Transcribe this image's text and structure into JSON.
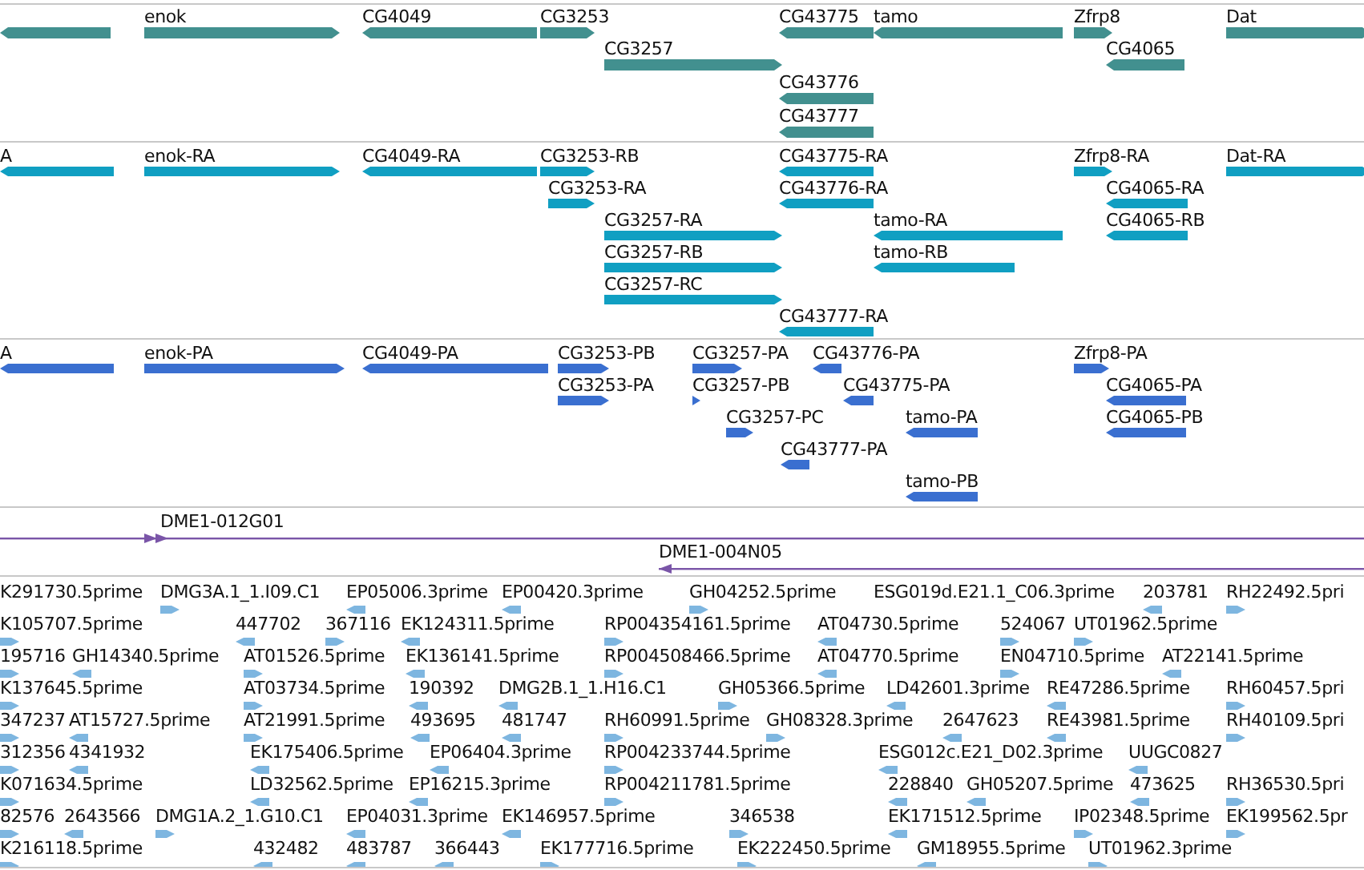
{
  "tracks": [
    {
      "kind": "gene",
      "features": [
        {
          "forward": false
        },
        {
          "label": "enok",
          "forward": true
        },
        {
          "label": "CG4049",
          "forward": false
        },
        {
          "label": "CG3253",
          "forward": true
        },
        {
          "label": "CG43775",
          "forward": false
        },
        {
          "label": "tamo",
          "forward": false
        },
        {
          "label": "Zfrp8",
          "forward": true
        },
        {
          "label": "Dat",
          "forward": true
        },
        {
          "label": "CG3257",
          "forward": true
        },
        {
          "label": "CG4065",
          "forward": false
        },
        {
          "label": "CG43776",
          "forward": false
        },
        {
          "label": "CG43777",
          "forward": false
        }
      ]
    },
    {
      "kind": "transcript",
      "features": [
        {
          "label": "A",
          "forward": false
        },
        {
          "label": "enok-RA",
          "forward": true
        },
        {
          "label": "CG4049-RA",
          "forward": false
        },
        {
          "label": "CG3253-RB",
          "forward": true
        },
        {
          "label": "CG43775-RA",
          "forward": false
        },
        {
          "label": "Zfrp8-RA",
          "forward": true
        },
        {
          "label": "Dat-RA",
          "forward": true
        },
        {
          "label": "CG3253-RA",
          "forward": true
        },
        {
          "label": "CG43776-RA",
          "forward": false
        },
        {
          "label": "CG4065-RA",
          "forward": false
        },
        {
          "label": "CG3257-RA",
          "forward": true
        },
        {
          "label": "tamo-RA",
          "forward": false
        },
        {
          "label": "CG4065-RB",
          "forward": false
        },
        {
          "label": "CG3257-RB",
          "forward": true
        },
        {
          "label": "tamo-RB",
          "forward": false
        },
        {
          "label": "CG3257-RC",
          "forward": true
        },
        {
          "label": "CG43777-RA",
          "forward": false
        }
      ]
    },
    {
      "kind": "cds",
      "features": [
        {
          "label": "A",
          "forward": false
        },
        {
          "label": "enok-PA",
          "forward": true
        },
        {
          "label": "CG4049-PA",
          "forward": false
        },
        {
          "label": "CG3253-PB",
          "forward": true
        },
        {
          "label": "CG3257-PA",
          "forward": true
        },
        {
          "label": "CG43776-PA",
          "forward": false
        },
        {
          "label": "Zfrp8-PA",
          "forward": true
        },
        {
          "label": "CG3253-PA",
          "forward": true
        },
        {
          "label": "CG3257-PB",
          "forward": true
        },
        {
          "label": "CG43775-PA",
          "forward": false
        },
        {
          "label": "CG4065-PA",
          "forward": false
        },
        {
          "label": "CG3257-PC",
          "forward": true
        },
        {
          "label": "tamo-PA",
          "forward": false
        },
        {
          "label": "CG4065-PB",
          "forward": false
        },
        {
          "label": "CG43777-PA",
          "forward": false
        },
        {
          "label": "tamo-PB",
          "forward": false
        }
      ]
    },
    {
      "kind": "clone",
      "features": [
        {
          "label": "DME1-012G01",
          "forward": true
        },
        {
          "label": "DME1-004N05",
          "forward": false
        }
      ]
    },
    {
      "kind": "est",
      "rows": [
        {
          "features": [
            {
              "label": "K291730.5prime"
            },
            {
              "label": "DMG3A.1_1.I09.C1",
              "forward": true
            },
            {
              "label": "EP05006.3prime",
              "forward": false
            },
            {
              "label": "EP00420.3prime",
              "forward": false
            },
            {
              "label": "GH04252.5prime",
              "forward": true
            },
            {
              "label": "ESG019d.E21.1_C06.3prime"
            },
            {
              "label": "203781",
              "forward": false
            },
            {
              "label": "RH22492.5pri",
              "forward": true
            }
          ]
        },
        {
          "features": [
            {
              "label": "K105707.5prime",
              "forward": true
            },
            {
              "label": "447702",
              "forward": false
            },
            {
              "label": "367116",
              "forward": true
            },
            {
              "label": "EK124311.5prime",
              "forward": false
            },
            {
              "label": "RP004354161.5prime",
              "forward": true
            },
            {
              "label": "AT04730.5prime",
              "forward": false
            },
            {
              "label": "524067",
              "forward": true
            },
            {
              "label": "UT01962.5prime",
              "forward": true
            }
          ]
        },
        {
          "features": [
            {
              "label": "195716",
              "forward": true
            },
            {
              "label": "GH14340.5prime",
              "forward": false
            },
            {
              "label": "AT01526.5prime",
              "forward": true
            },
            {
              "label": "EK136141.5prime",
              "forward": false
            },
            {
              "label": "RP004508466.5prime",
              "forward": true
            },
            {
              "label": "AT04770.5prime",
              "forward": false
            },
            {
              "label": "EN04710.5prime",
              "forward": true
            },
            {
              "label": "AT22141.5prime",
              "forward": false
            }
          ]
        },
        {
          "features": [
            {
              "label": "K137645.5prime",
              "forward": true
            },
            {
              "label": "AT03734.5prime",
              "forward": true
            },
            {
              "label": "190392",
              "forward": false
            },
            {
              "label": "DMG2B.1_1.H16.C1",
              "forward": false
            },
            {
              "label": "GH05366.5prime",
              "forward": true
            },
            {
              "label": "LD42601.3prime",
              "forward": false
            },
            {
              "label": "RE47286.5prime",
              "forward": false
            },
            {
              "label": "RH60457.5pri",
              "forward": true
            }
          ]
        },
        {
          "features": [
            {
              "label": "347237",
              "forward": true
            },
            {
              "label": "AT15727.5prime",
              "forward": false
            },
            {
              "label": "AT21991.5prime",
              "forward": true
            },
            {
              "label": "493695",
              "forward": false
            },
            {
              "label": "481747",
              "forward": false
            },
            {
              "label": "RH60991.5prime",
              "forward": true
            },
            {
              "label": "GH08328.3prime",
              "forward": true
            },
            {
              "label": "2647623",
              "forward": false
            },
            {
              "label": "RE43981.5prime",
              "forward": false
            },
            {
              "label": "RH40109.5pri",
              "forward": true
            }
          ]
        },
        {
          "features": [
            {
              "label": "312356",
              "forward": true
            },
            {
              "label": "4341932",
              "forward": false
            },
            {
              "label": "EK175406.5prime",
              "forward": false
            },
            {
              "label": "EP06404.3prime",
              "forward": false
            },
            {
              "label": "RP004233744.5prime",
              "forward": true
            },
            {
              "label": "ESG012c.E21_D02.3prime",
              "forward": false
            },
            {
              "label": "UUGC0827",
              "forward": false
            }
          ]
        },
        {
          "features": [
            {
              "label": "K071634.5prime",
              "forward": true
            },
            {
              "label": "LD32562.5prime",
              "forward": false
            },
            {
              "label": "EP16215.3prime",
              "forward": false
            },
            {
              "label": "RP004211781.5prime",
              "forward": true
            },
            {
              "label": "228840",
              "forward": false
            },
            {
              "label": "GH05207.5prime",
              "forward": false
            },
            {
              "label": "473625",
              "forward": false
            },
            {
              "label": "RH36530.5pri",
              "forward": true
            }
          ]
        },
        {
          "features": [
            {
              "label": "82576",
              "forward": true
            },
            {
              "label": "2643566",
              "forward": false
            },
            {
              "label": "DMG1A.2_1.G10.C1",
              "forward": true
            },
            {
              "label": "EP04031.3prime",
              "forward": false
            },
            {
              "label": "EK146957.5prime",
              "forward": false
            },
            {
              "label": "346538",
              "forward": true
            },
            {
              "label": "EK171512.5prime",
              "forward": false
            },
            {
              "label": "IP02348.5prime",
              "forward": true
            },
            {
              "label": "EK199562.5pr",
              "forward": true
            }
          ]
        },
        {
          "features": [
            {
              "label": "K216118.5prime",
              "forward": true
            },
            {
              "label": "432482",
              "forward": false
            },
            {
              "label": "483787",
              "forward": false
            },
            {
              "label": "366443",
              "forward": false
            },
            {
              "label": "EK177716.5prime",
              "forward": true
            },
            {
              "label": "EK222450.5prime",
              "forward": true
            },
            {
              "label": "GM18955.5prime",
              "forward": false
            },
            {
              "label": "UT01962.3prime",
              "forward": true
            }
          ]
        }
      ]
    }
  ]
}
